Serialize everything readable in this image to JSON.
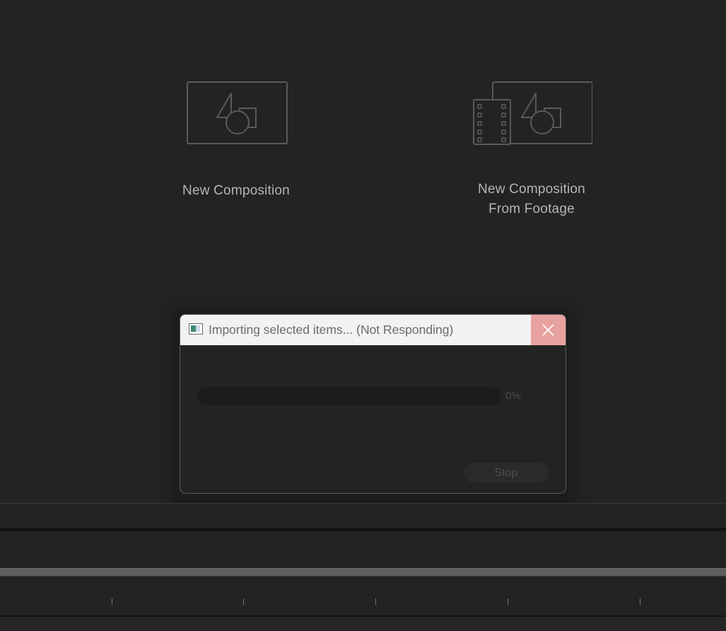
{
  "start_panel": {
    "new_composition_label": "New Composition",
    "from_footage_label_line1": "New Composition",
    "from_footage_label_line2": "From Footage"
  },
  "dialog": {
    "title": "Importing selected items... (Not Responding)",
    "progress_percent_label": "0%",
    "progress_value": 0,
    "stop_label": "Stop"
  },
  "colors": {
    "background": "#232323",
    "titlebar": "#f2f2f2",
    "close_button": "#e8a3a1",
    "icon_stroke": "#5a5a5a"
  }
}
